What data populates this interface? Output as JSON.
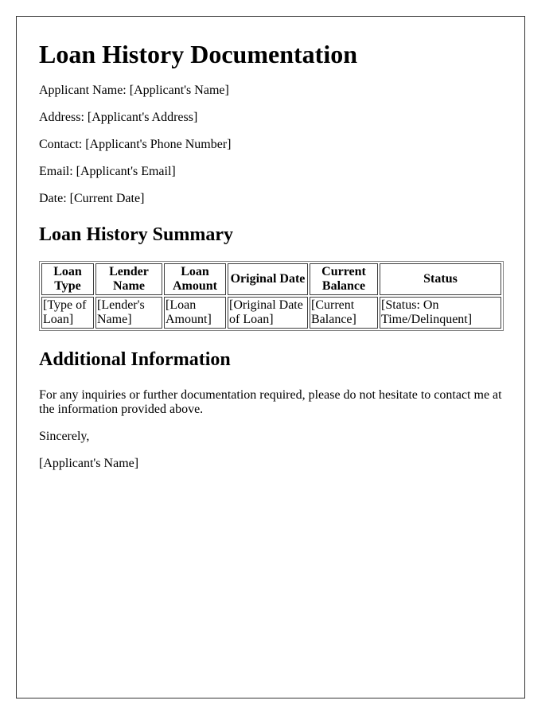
{
  "document": {
    "title": "Loan History Documentation",
    "applicant_info": [
      {
        "label": "Applicant Name:",
        "value": "[Applicant's Name]"
      },
      {
        "label": "Address:",
        "value": "[Applicant's Address]"
      },
      {
        "label": "Contact:",
        "value": "[Applicant's Phone Number]"
      },
      {
        "label": "Email:",
        "value": "[Applicant's Email]"
      },
      {
        "label": "Date:",
        "value": "[Current Date]"
      }
    ],
    "summary_heading": "Loan History Summary",
    "table": {
      "headers": [
        "Loan Type",
        "Lender Name",
        "Loan Amount",
        "Original Date",
        "Current Balance",
        "Status"
      ],
      "rows": [
        [
          "[Type of Loan]",
          "[Lender's Name]",
          "[Loan Amount]",
          "[Original Date of Loan]",
          "[Current Balance]",
          "[Status: On Time/Delinquent]"
        ]
      ]
    },
    "additional_heading": "Additional Information",
    "additional_text": "For any inquiries or further documentation required, please do not hesitate to contact me at the information provided above.",
    "closing": "Sincerely,",
    "signature": "[Applicant's Name]"
  }
}
